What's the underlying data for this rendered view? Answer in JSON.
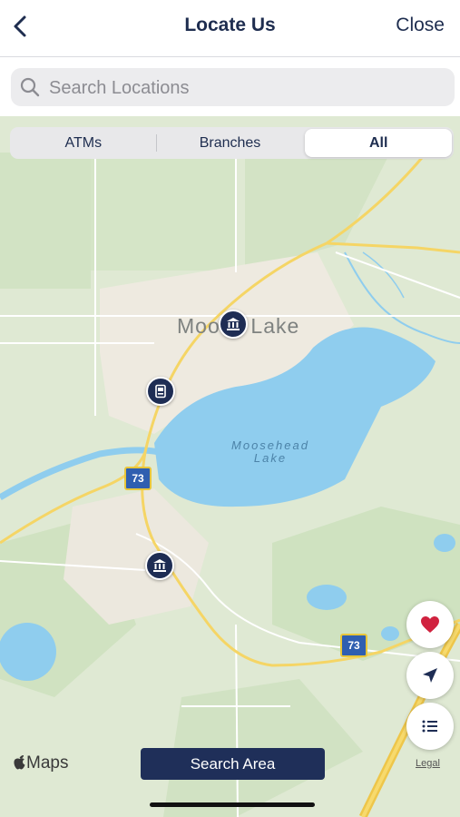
{
  "header": {
    "title": "Locate Us",
    "close_label": "Close",
    "back_icon": "chevron-left-icon"
  },
  "search": {
    "placeholder": "Search Locations",
    "value": ""
  },
  "filters": {
    "items": [
      "ATMs",
      "Branches",
      "All"
    ],
    "selected": "All"
  },
  "map": {
    "place_label": "Moose Lake",
    "lake_label_line1": "Moosehead",
    "lake_label_line2": "Lake",
    "highway_shield": "73",
    "pins": [
      "bank-branch-icon",
      "atm-icon",
      "bank-branch-icon"
    ],
    "attribution": "Maps",
    "legal": "Legal"
  },
  "actions": {
    "search_area_label": "Search Area",
    "favorites_icon": "heart-icon",
    "locate_icon": "location-arrow-icon",
    "list_icon": "list-icon"
  },
  "colors": {
    "brand": "#1e2d54",
    "favorite": "#d0223f",
    "water": "#8fcdee",
    "road": "#f5d565"
  }
}
